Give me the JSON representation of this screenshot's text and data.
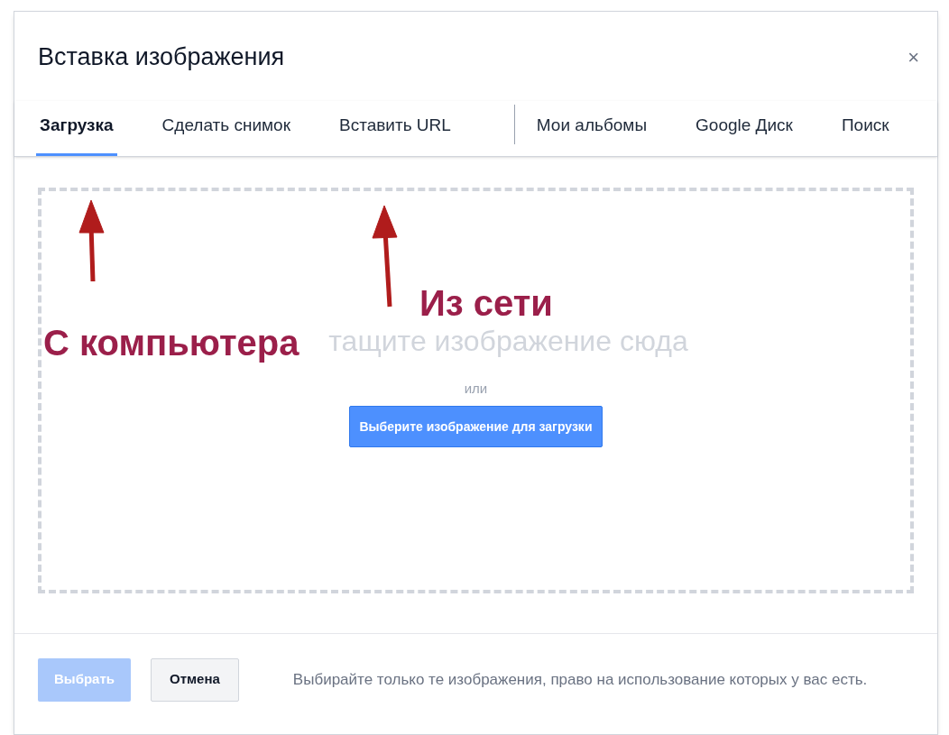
{
  "dialog": {
    "title": "Вставка изображения",
    "close": "×"
  },
  "tabs": [
    {
      "label": "Загрузка",
      "selected": true
    },
    {
      "label": "Сделать снимок",
      "selected": false
    },
    {
      "label": "Вставить URL",
      "selected": false
    },
    {
      "label": "Мои альбомы",
      "selected": false
    },
    {
      "label": "Google Диск",
      "selected": false
    },
    {
      "label": "Поиск",
      "selected": false
    }
  ],
  "drop_zone": {
    "text": "тащите изображение сюда",
    "or": "или",
    "button": "Выберите изображение для загрузки"
  },
  "annotations": [
    {
      "text": "С компьютера"
    },
    {
      "text": "Из сети"
    }
  ],
  "footer": {
    "select_button": {
      "label": "Выбрать",
      "disabled": true
    },
    "cancel_button": "Отмена",
    "note": "Выбирайте только те изображения, право на использование которых у вас есть."
  }
}
